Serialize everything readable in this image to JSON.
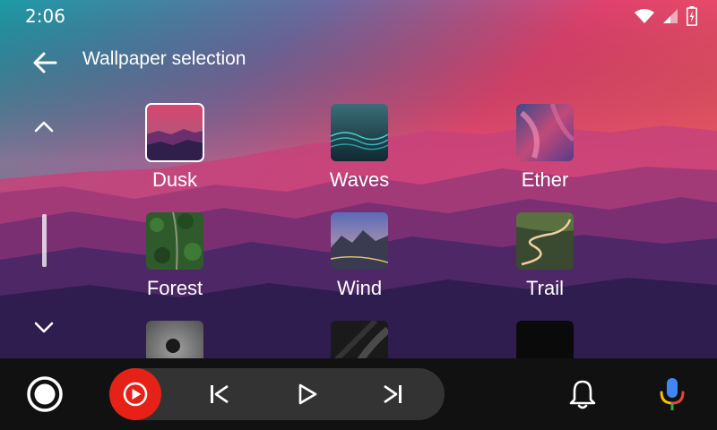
{
  "status_bar": {
    "time": "2:06"
  },
  "header": {
    "title": "Wallpaper selection"
  },
  "wallpapers": [
    {
      "label": "Dusk",
      "selected": true
    },
    {
      "label": "Waves",
      "selected": false
    },
    {
      "label": "Ether",
      "selected": false
    },
    {
      "label": "Forest",
      "selected": false
    },
    {
      "label": "Wind",
      "selected": false
    },
    {
      "label": "Trail",
      "selected": false
    },
    {
      "label": "",
      "selected": false
    },
    {
      "label": "",
      "selected": false
    },
    {
      "label": "",
      "selected": false
    }
  ],
  "icons": {
    "back": "arrow-left-icon",
    "scroll_up": "chevron-up-icon",
    "scroll_down": "chevron-down-icon",
    "home": "home-circle-icon",
    "app": "youtube-music-icon",
    "previous": "skip-previous-icon",
    "play": "play-icon",
    "next": "skip-next-icon",
    "notifications": "bell-icon",
    "voice": "mic-icon"
  },
  "colors": {
    "app_accent": "#e62117",
    "nav_bar": "#111111",
    "media_pill": "#333333"
  }
}
